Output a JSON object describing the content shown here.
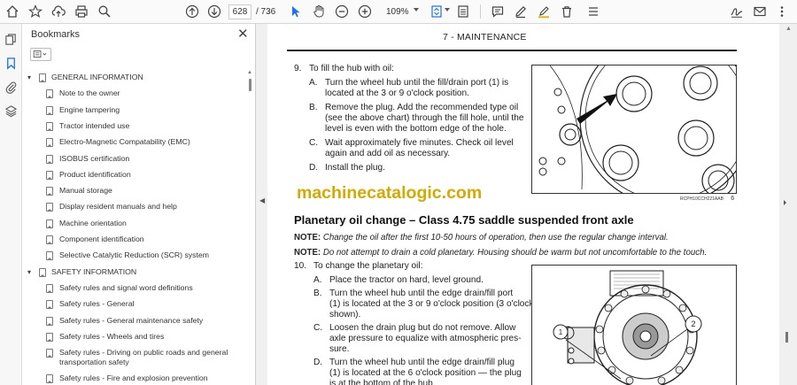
{
  "toolbar": {
    "page_current": "628",
    "page_total": "/ 736",
    "zoom": "109%"
  },
  "bookmarks": {
    "title": "Bookmarks",
    "items": [
      {
        "label": "GENERAL INFORMATION",
        "level": 0
      },
      {
        "label": "Note to the owner",
        "level": 1
      },
      {
        "label": "Engine tampering",
        "level": 1
      },
      {
        "label": "Tractor intended use",
        "level": 1
      },
      {
        "label": "Electro-Magnetic Compatability (EMC)",
        "level": 1
      },
      {
        "label": "ISOBUS certification",
        "level": 1
      },
      {
        "label": "Product identification",
        "level": 1
      },
      {
        "label": "Manual storage",
        "level": 1
      },
      {
        "label": "Display resident manuals and help",
        "level": 1
      },
      {
        "label": "Machine orientation",
        "level": 1
      },
      {
        "label": "Component identification",
        "level": 1
      },
      {
        "label": "Selective Catalytic Reduction (SCR) system",
        "level": 1
      },
      {
        "label": "SAFETY INFORMATION",
        "level": 0
      },
      {
        "label": "Safety rules and signal word definitions",
        "level": 1
      },
      {
        "label": "Safety rules - General",
        "level": 1
      },
      {
        "label": "Safety rules - General maintenance safety",
        "level": 1
      },
      {
        "label": "Safety rules - Wheels and tires",
        "level": 1
      },
      {
        "label": "Safety rules - Driving on public roads and general",
        "label2": "transportation safety",
        "level": 1
      },
      {
        "label": "Safety rules - Fire and explosion prevention",
        "level": 1
      }
    ]
  },
  "page": {
    "header": "7 - MAINTENANCE",
    "step9": {
      "num": "9.",
      "title": "To fill the hub with oil:",
      "items": [
        {
          "letter": "A.",
          "lines": [
            "Turn the wheel hub until the fill/drain port (1) is",
            "located at the 3 or 9 o'clock position."
          ]
        },
        {
          "letter": "B.",
          "lines": [
            "Remove the plug.  Add the recommended type oil",
            "(see the above chart) through the fill hole, until the",
            "level is even with the bottom edge of the hole."
          ]
        },
        {
          "letter": "C.",
          "lines": [
            "Wait approximately five minutes.  Check oil level",
            "again and add oil as necessary."
          ]
        },
        {
          "letter": "D.",
          "lines": [
            "Install the plug."
          ]
        }
      ]
    },
    "watermark": "machinecatalogic.com",
    "fig1_caption": "RCPH10CCH221AAB",
    "fig1_number": "6",
    "section_title": "Planetary oil change – Class 4.75 saddle suspended front axle",
    "note1_label": "NOTE:",
    "note1_text": " Change the oil after the first 10-50 hours of operation, then use the regular change interval.",
    "note2_label": "NOTE:",
    "note2_text": " Do not attempt to drain a cold planetary. Housing should be warm but not uncomfortable to the touch.",
    "step10": {
      "num": "10.",
      "title": "To change the planetary oil:",
      "items": [
        {
          "letter": "A.",
          "lines": [
            "Place the tractor on hard, level ground."
          ]
        },
        {
          "letter": "B.",
          "lines": [
            "Turn the wheel hub until the edge drain/fill port",
            "(1) is located at the 3 or 9 o'clock position (3 o'clock",
            "shown)."
          ]
        },
        {
          "letter": "C.",
          "lines": [
            "Loosen the drain plug but do not remove.  Allow",
            "axle pressure to equalize with atmospheric pres-",
            "sure."
          ]
        },
        {
          "letter": "D.",
          "lines": [
            "Turn the wheel hub until the edge drain/fill plug",
            "(1) is located at the 6 o'clock position — the plug",
            "is at the bottom of the hub."
          ]
        }
      ]
    },
    "fig2_callout1": "1",
    "fig2_callout2": "2"
  }
}
